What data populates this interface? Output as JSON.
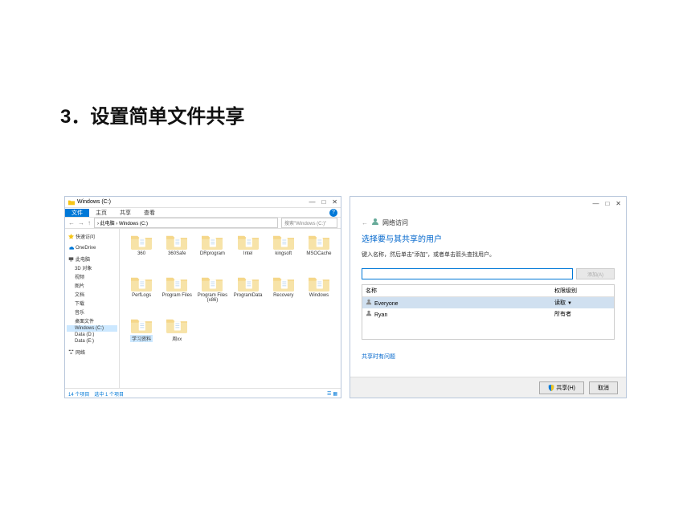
{
  "slide": {
    "title": "3．设置简单文件共享"
  },
  "explorer": {
    "window_title": "Windows (C:)",
    "ribbon": {
      "file": "文件",
      "home": "主页",
      "share": "共享",
      "view": "查看"
    },
    "breadcrumb": "› 此电脑 › Windows (C:)",
    "search_placeholder": "搜索\"Windows (C:)\"",
    "sidebar": {
      "quickaccess": "快速访问",
      "onedrive": "OneDrive",
      "thispc": "此电脑",
      "objects3d": "3D 对象",
      "videos": "视频",
      "pictures": "图片",
      "documents": "文档",
      "downloads": "下载",
      "music": "音乐",
      "desktop": "桌面文件",
      "windowsc": "Windows (C:)",
      "datad": "Data (D:)",
      "datae": "Data (E:)",
      "network": "网络"
    },
    "folders": [
      "360",
      "360Safe",
      "DRprogram",
      "Intel",
      "kingsoft",
      "MSOCache",
      "PerfLogs",
      "Program Files",
      "Program Files (x86)",
      "ProgramData",
      "Recovery",
      "Windows",
      "学习资料",
      "周xx"
    ],
    "selected_folder_index": 12,
    "status": "14 个项目　选中 1 个项目"
  },
  "share": {
    "header": "网络访问",
    "subtitle": "选择要与其共享的用户",
    "instruction": "键入名称，然后单击\"添加\"，或者单击箭头查找用户。",
    "input_value": "",
    "add_button": "添加(A)",
    "col_name": "名称",
    "col_perm": "权限级别",
    "rows": [
      {
        "name": "Everyone",
        "perm": "读取",
        "selected": true,
        "has_dropdown": true
      },
      {
        "name": "Ryan",
        "perm": "所有者",
        "selected": false,
        "has_dropdown": false
      }
    ],
    "trouble_link": "共享时有问题",
    "share_button": "共享(H)",
    "cancel_button": "取消"
  }
}
